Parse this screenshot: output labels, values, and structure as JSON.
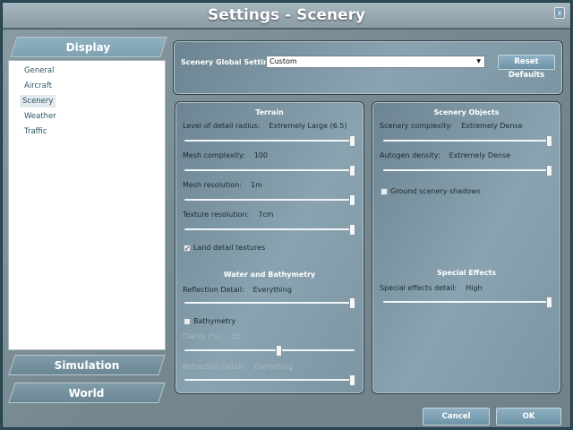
{
  "title": "Settings - Scenery",
  "close_label": "x",
  "categories": {
    "display": "Display",
    "simulation": "Simulation",
    "world": "World"
  },
  "nav_items": [
    "General",
    "Aircraft",
    "Scenery",
    "Weather",
    "Traffic"
  ],
  "selected_item": "Scenery",
  "global": {
    "label": "Scenery Global Settings:",
    "value": "Custom",
    "reset": "Reset Defaults"
  },
  "terrain": {
    "title": "Terrain",
    "lod": {
      "label": "Level of detail radius:",
      "value": "Extremely Large (6.5)",
      "fraction": 1
    },
    "mesh_complexity": {
      "label": "Mesh complexity:",
      "value": "100",
      "fraction": 1
    },
    "mesh_resolution": {
      "label": "Mesh resolution:",
      "value": "1m",
      "fraction": 1
    },
    "texture_resolution": {
      "label": "Texture resolution:",
      "value": "7cm",
      "fraction": 1
    },
    "land_detail": {
      "label": "Land detail textures",
      "checked": true
    }
  },
  "water": {
    "title": "Water and Bathymetry",
    "reflection": {
      "label": "Reflection Detail:",
      "value": "Everything",
      "fraction": 1
    },
    "bathymetry": {
      "label": "Bathymetry",
      "checked": false
    },
    "clarity": {
      "label": "Clarity (%):",
      "value": "55",
      "fraction": 0.55
    },
    "refraction": {
      "label": "Refraction Detail:",
      "value": "Everything",
      "fraction": 1
    }
  },
  "objects": {
    "title": "Scenery Objects",
    "complexity": {
      "label": "Scenery complexity:",
      "value": "Extremely Dense",
      "fraction": 1
    },
    "autogen": {
      "label": "Autogen density:",
      "value": "Extremely Dense",
      "fraction": 1
    },
    "shadows": {
      "label": "Ground scenery shadows",
      "checked": false
    }
  },
  "effects": {
    "title": "Special Effects",
    "detail": {
      "label": "Special effects detail:",
      "value": "High",
      "fraction": 1
    }
  },
  "footer": {
    "cancel": "Cancel",
    "ok": "OK"
  }
}
